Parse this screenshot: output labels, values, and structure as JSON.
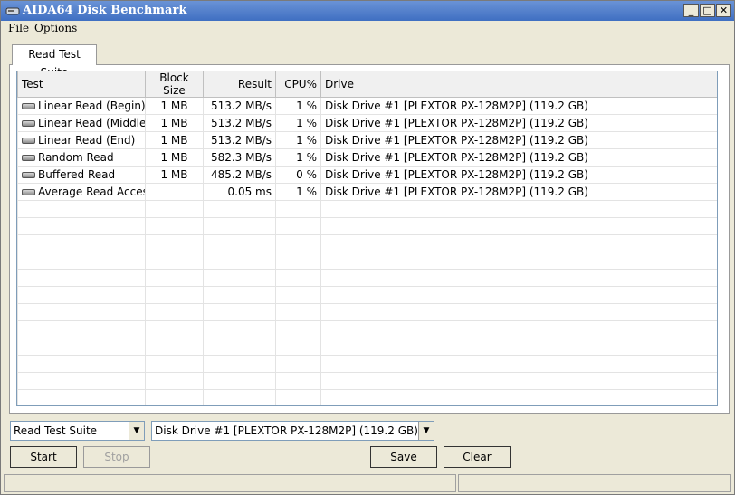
{
  "window": {
    "title": "AIDA64 Disk Benchmark"
  },
  "titlebar": {
    "minimize_glyph": "_",
    "maximize_glyph": "□",
    "close_glyph": "✕"
  },
  "menu": {
    "file": "File",
    "options": "Options"
  },
  "tab": {
    "label": "Read Test Suite"
  },
  "table": {
    "headers": {
      "test": "Test",
      "block": "Block Size",
      "result": "Result",
      "cpu": "CPU%",
      "drive": "Drive"
    },
    "rows": [
      {
        "test": "Linear Read (Begin)",
        "block": "1 MB",
        "result": "513.2 MB/s",
        "cpu": "1 %",
        "drive": "Disk Drive #1  [PLEXTOR  PX-128M2P]  (119.2 GB)"
      },
      {
        "test": "Linear Read (Middle)",
        "block": "1 MB",
        "result": "513.2 MB/s",
        "cpu": "1 %",
        "drive": "Disk Drive #1  [PLEXTOR  PX-128M2P]  (119.2 GB)"
      },
      {
        "test": "Linear Read (End)",
        "block": "1 MB",
        "result": "513.2 MB/s",
        "cpu": "1 %",
        "drive": "Disk Drive #1  [PLEXTOR  PX-128M2P]  (119.2 GB)"
      },
      {
        "test": "Random Read",
        "block": "1 MB",
        "result": "582.3 MB/s",
        "cpu": "1 %",
        "drive": "Disk Drive #1  [PLEXTOR  PX-128M2P]  (119.2 GB)"
      },
      {
        "test": "Buffered Read",
        "block": "1 MB",
        "result": "485.2 MB/s",
        "cpu": "0 %",
        "drive": "Disk Drive #1  [PLEXTOR  PX-128M2P]  (119.2 GB)"
      },
      {
        "test": "Average Read Access",
        "block": "",
        "result": "0.05 ms",
        "cpu": "1 %",
        "drive": "Disk Drive #1  [PLEXTOR  PX-128M2P]  (119.2 GB)"
      }
    ]
  },
  "controls": {
    "suite_select": "Read Test Suite",
    "drive_select": "Disk Drive #1  [PLEXTOR  PX-128M2P]  (119.2 GB)",
    "start": "Start",
    "stop": "Stop",
    "save": "Save",
    "clear": "Clear"
  },
  "icons": {
    "row_icon": "drive-icon",
    "app_icon": "disk-benchmark-icon"
  }
}
